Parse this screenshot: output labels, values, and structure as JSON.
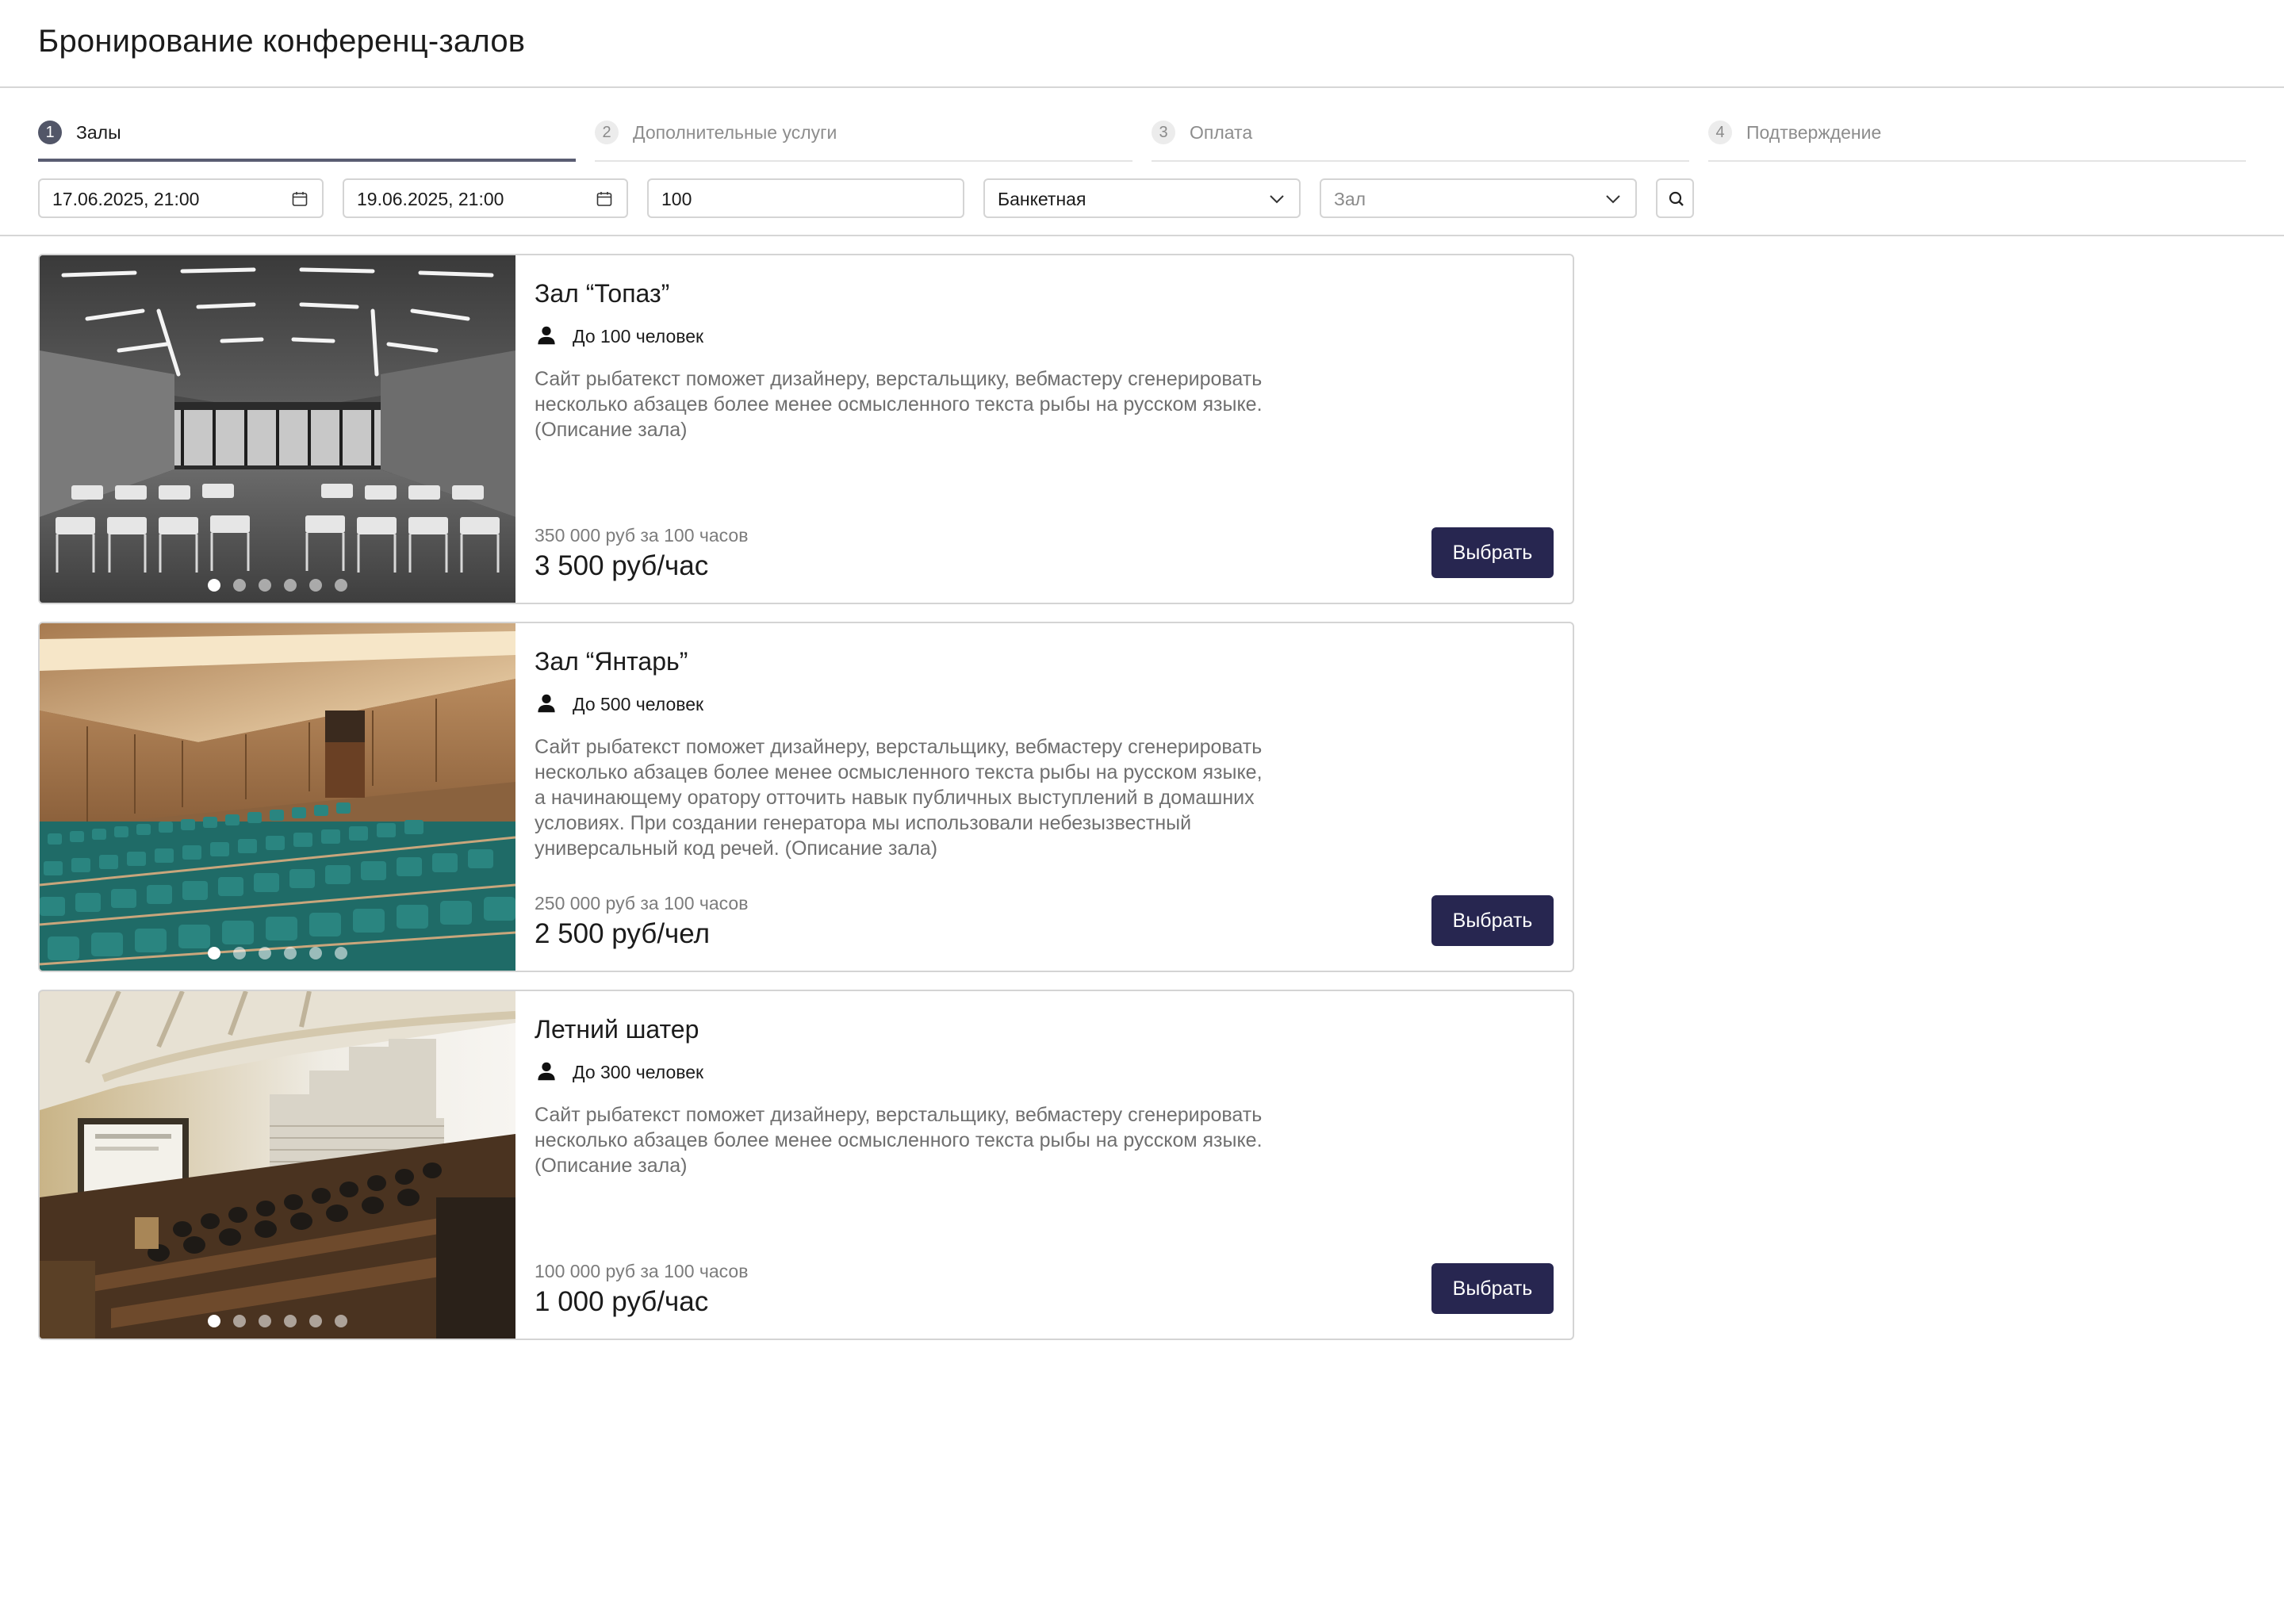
{
  "header": {
    "title": "Бронирование конференц-залов"
  },
  "steps": [
    {
      "num": "1",
      "label": "Залы",
      "active": true
    },
    {
      "num": "2",
      "label": "Дополнительные услуги",
      "active": false
    },
    {
      "num": "3",
      "label": "Оплата",
      "active": false
    },
    {
      "num": "4",
      "label": "Подтверждение",
      "active": false
    }
  ],
  "filters": {
    "date_from": "17.06.2025, 21:00",
    "date_to": "19.06.2025, 21:00",
    "guests": "100",
    "seating": "Банкетная",
    "hall_placeholder": "Зал"
  },
  "halls": [
    {
      "name": "Зал “Топаз”",
      "capacity": "До 100 человек",
      "description": "Сайт рыбатекст поможет дизайнеру, верстальщику, вебмастеру сгенерировать несколько абзацев более менее осмысленного текста рыбы на русском языке. (Описание зала)",
      "price_total": "350 000 руб за 100 часов",
      "price_rate": "3 500 руб/час",
      "button": "Выбрать",
      "photo_icon": "conference-room-photo-grayscale",
      "slides": 6,
      "active_slide": 1
    },
    {
      "name": "Зал “Янтарь”",
      "capacity": "До 500 человек",
      "description": "Сайт рыбатекст поможет дизайнеру, верстальщику, вебмастеру сгенерировать несколько абзацев более менее осмысленного текста рыбы на русском языке, а начинающему оратору отточить навык публичных выступлений в домашних условиях. При создании генератора мы использовали небезызвестный универсальный код речей. (Описание зала)",
      "price_total": "250 000 руб за 100 часов",
      "price_rate": "2 500 руб/чел",
      "button": "Выбрать",
      "photo_icon": "auditorium-photo-amber",
      "slides": 6,
      "active_slide": 1
    },
    {
      "name": "Летний шатер",
      "capacity": "До 300 человек",
      "description": "Сайт рыбатекст поможет дизайнеру, верстальщику, вебмастеру сгенерировать несколько абзацев более менее осмысленного текста рыбы на русском языке. (Описание зала)",
      "price_total": "100 000 руб за 100 часов",
      "price_rate": "1 000 руб/час",
      "button": "Выбрать",
      "photo_icon": "lecture-hall-photo",
      "slides": 6,
      "active_slide": 1
    }
  ],
  "colors": {
    "primary_button": "#272650",
    "active_step": "#525668"
  }
}
